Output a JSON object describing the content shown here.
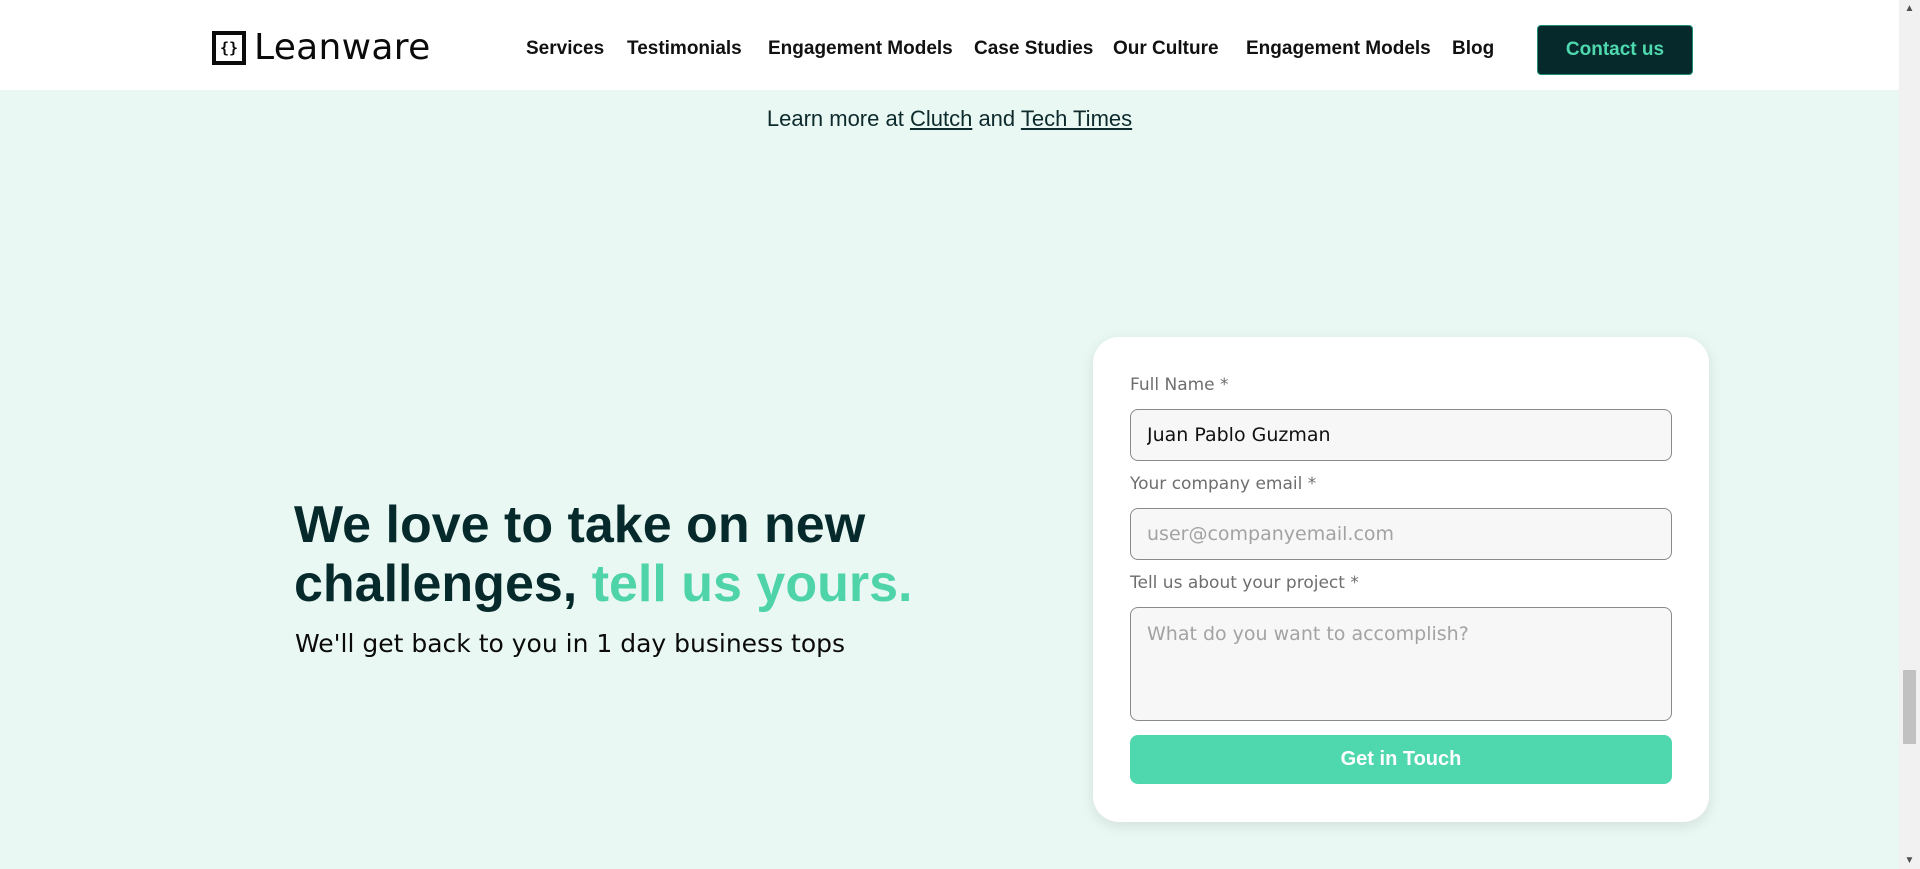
{
  "header": {
    "logo_mark": "{}",
    "logo_text": "Leanware",
    "nav": [
      {
        "label": "Services"
      },
      {
        "label": "Testimonials"
      },
      {
        "label": "Engagement Models"
      },
      {
        "label": "Case Studies"
      },
      {
        "label": "Our Culture"
      },
      {
        "label": "Engagement Models"
      },
      {
        "label": "Blog"
      }
    ],
    "contact_label": "Contact us"
  },
  "learn_more": {
    "prefix": "Learn more at",
    "link1": "Clutch",
    "connector": "and",
    "link2": "Tech Times"
  },
  "hero": {
    "title_main": "We love to take on new challenges,",
    "title_accent": "tell us yours.",
    "subtitle": "We'll get back to you in 1 day business tops"
  },
  "form": {
    "name_label": "Full Name *",
    "name_value": "Juan Pablo Guzman",
    "email_label": "Your company email  *",
    "email_placeholder": "user@companyemail.com",
    "project_label": "Tell us about your project *",
    "project_placeholder": "What do you want to accomplish?",
    "submit_label": "Get in Touch"
  },
  "colors": {
    "background": "#eaf8f3",
    "dark": "#062a2c",
    "accent": "#4fd8ad"
  }
}
